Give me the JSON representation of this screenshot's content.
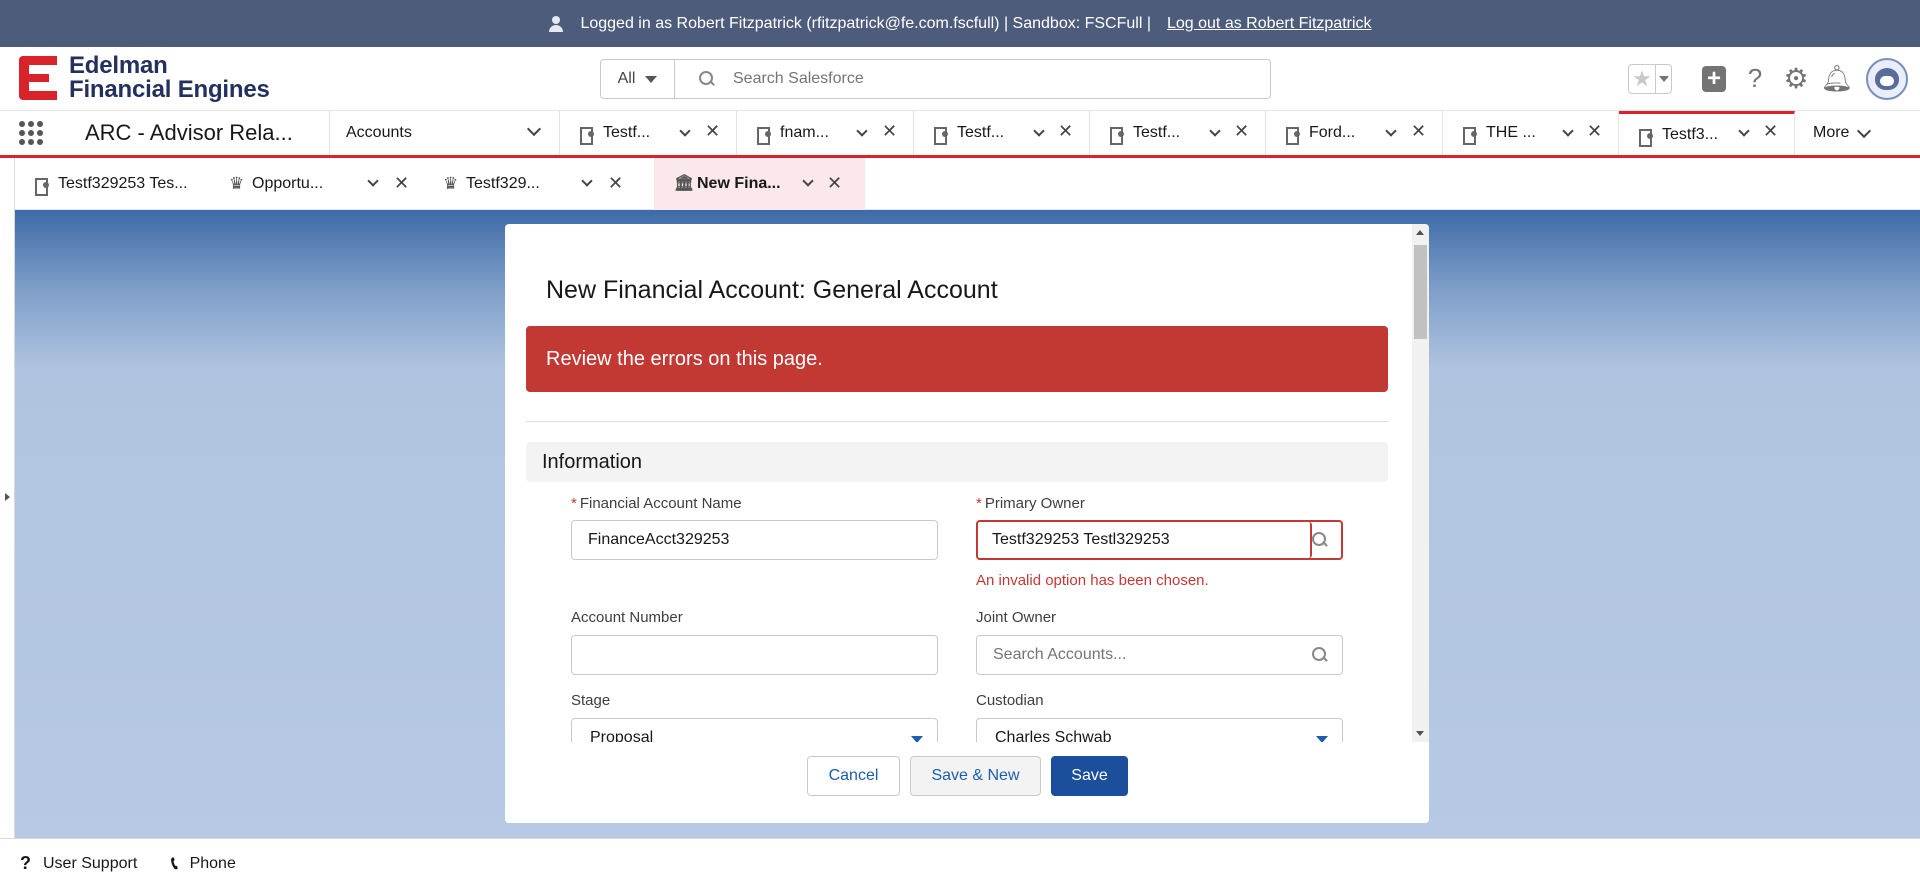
{
  "banner": {
    "logged_in_text": "Logged in as Robert Fitzpatrick (rfitzpatrick@fe.com.fscfull) | Sandbox: FSCFull |",
    "logout_link": "Log out as Robert Fitzpatrick"
  },
  "header": {
    "logo_line1": "Edelman",
    "logo_line2": "Financial Engines",
    "search_scope": "All",
    "search_placeholder": "Search Salesforce"
  },
  "nav": {
    "app_name": "ARC - Advisor Rela...",
    "accounts_label": "Accounts",
    "tabs": [
      {
        "label": "Testf..."
      },
      {
        "label": "fnam..."
      },
      {
        "label": "Testf..."
      },
      {
        "label": "Testf..."
      },
      {
        "label": "Ford..."
      },
      {
        "label": "THE ..."
      },
      {
        "label": "Testf3..."
      }
    ],
    "more_label": "More"
  },
  "subtabs": [
    {
      "label": "Testf329253 Tes..."
    },
    {
      "label": "Opportu..."
    },
    {
      "label": "Testf329..."
    },
    {
      "label": "New Fina..."
    }
  ],
  "modal": {
    "title": "New Financial Account: General Account",
    "error_banner": "Review the errors on this page.",
    "section_title": "Information",
    "fields": {
      "financial_account_name": {
        "label": "Financial Account Name",
        "value": "FinanceAcct329253",
        "required": "*"
      },
      "primary_owner": {
        "label": "Primary Owner",
        "value": "Testf329253 Testl329253",
        "required": "*",
        "error": "An invalid option has been chosen."
      },
      "account_number": {
        "label": "Account Number",
        "value": ""
      },
      "joint_owner": {
        "label": "Joint Owner",
        "placeholder": "Search Accounts..."
      },
      "stage": {
        "label": "Stage",
        "value": "Proposal"
      },
      "custodian": {
        "label": "Custodian",
        "value": "Charles Schwab"
      }
    },
    "buttons": {
      "cancel": "Cancel",
      "save_new": "Save & New",
      "save": "Save"
    }
  },
  "utility": {
    "user_support": "User Support",
    "phone": "Phone"
  },
  "colors": {
    "banner_bg": "#4e5c7c",
    "brand_red": "#d8232a",
    "error_red": "#c23934",
    "brand_blue": "#1b4f9c"
  }
}
